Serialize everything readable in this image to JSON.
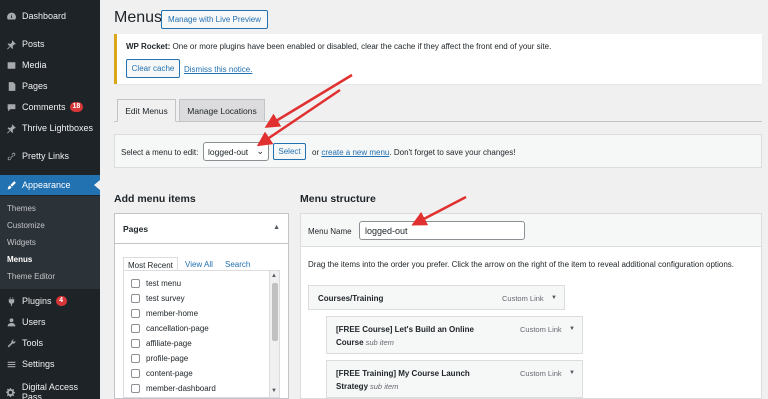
{
  "sidebar": {
    "items": [
      {
        "label": "Dashboard",
        "icon": "dashboard-icon"
      },
      {
        "label": "Posts",
        "icon": "pin-icon"
      },
      {
        "label": "Media",
        "icon": "media-icon"
      },
      {
        "label": "Pages",
        "icon": "page-icon"
      },
      {
        "label": "Comments",
        "icon": "comment-icon",
        "badge": "18"
      },
      {
        "label": "Thrive Lightboxes",
        "icon": "pin-icon"
      },
      {
        "label": "Pretty Links",
        "icon": "link-icon"
      },
      {
        "label": "Appearance",
        "icon": "brush-icon"
      },
      {
        "label": "Plugins",
        "icon": "plugin-icon",
        "badge": "4"
      },
      {
        "label": "Users",
        "icon": "user-icon"
      },
      {
        "label": "Tools",
        "icon": "wrench-icon"
      },
      {
        "label": "Settings",
        "icon": "settings-icon"
      },
      {
        "label": "Digital Access Pass",
        "icon": "gear-icon"
      }
    ],
    "submenu": [
      "Themes",
      "Customize",
      "Widgets",
      "Menus",
      "Theme Editor"
    ]
  },
  "header": {
    "title": "Menus",
    "live_preview_label": "Manage with Live Preview"
  },
  "notice": {
    "strong": "WP Rocket:",
    "text": " One or more plugins have been enabled or disabled, clear the cache if they affect the front end of your site.",
    "clear_cache_label": "Clear cache",
    "dismiss_label": "Dismiss this notice."
  },
  "tabs": {
    "edit_menus": "Edit Menus",
    "manage_locations": "Manage Locations"
  },
  "select_bar": {
    "label": "Select a menu to edit:",
    "selected": "logged-out",
    "select_button": "Select",
    "or": "or ",
    "create_link": "create a new menu",
    "after": ". Don't forget to save your changes!"
  },
  "add_items": {
    "heading": "Add menu items",
    "pages_title": "Pages",
    "subtabs": [
      "Most Recent",
      "View All",
      "Search"
    ],
    "pages": [
      "test menu",
      "test survey",
      "member-home",
      "cancellation-page",
      "affiliate-page",
      "profile-page",
      "content-page",
      "member-dashboard"
    ]
  },
  "structure": {
    "heading": "Menu structure",
    "menu_name_label": "Menu Name",
    "menu_name_value": "logged-out",
    "drag_text": "Drag the items into the order you prefer. Click the arrow on the right of the item to reveal additional configuration options.",
    "items": [
      {
        "title": "Courses/Training",
        "type": "Custom Link",
        "sub": ""
      },
      {
        "title": "[FREE Course] Let's Build an Online",
        "title2": "Course",
        "type": "Custom Link",
        "sub": "sub item"
      },
      {
        "title": "[FREE Training] My Course Launch",
        "title2": "Strategy",
        "type": "Custom Link",
        "sub": "sub item"
      }
    ]
  },
  "colors": {
    "accent": "#2271b1",
    "sidebar": "#1d2327",
    "arrow": "#e0302f",
    "notice_border": "#dba617"
  }
}
